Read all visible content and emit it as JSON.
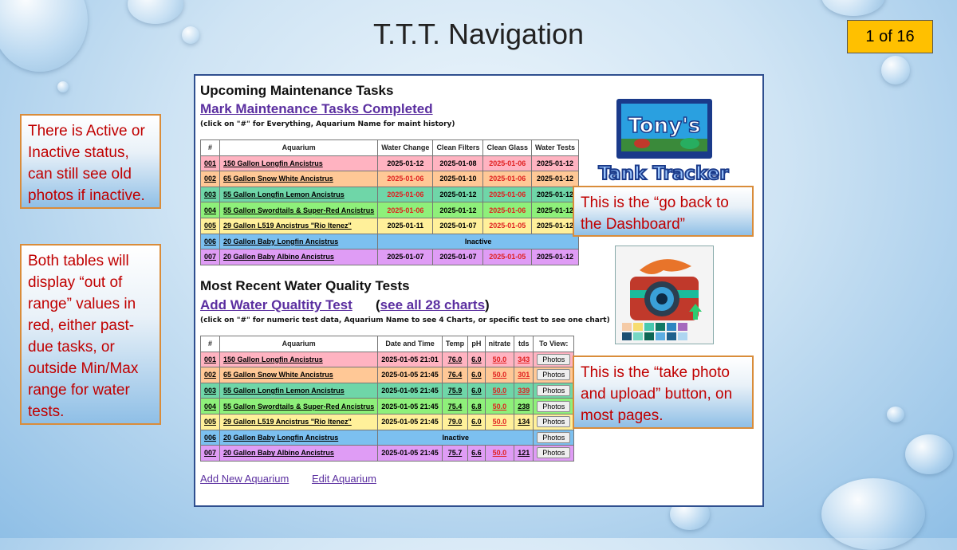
{
  "slide": {
    "title": "T.T.T. Navigation",
    "page": "1 of 16"
  },
  "callouts": {
    "status": "There is Active or Inactive status, can still see old photos if inactive.",
    "tables": "Both tables will display “out of range” values in red, either past-due tasks, or outside Min/Max range for water tests.",
    "dashboard": "This is the “go back to the Dashboard”",
    "photo": "This is the “take photo and upload” button, on most pages."
  },
  "logo": {
    "line1": "Tony's",
    "line2": "Tank Tracker"
  },
  "maintenance": {
    "heading": "Upcoming Maintenance Tasks",
    "link": "Mark Maintenance Tasks Completed",
    "note": "(click on \"#\" for Everything, Aquarium Name for maint history)",
    "columns": [
      "#",
      "Aquarium",
      "Water Change",
      "Clean Filters",
      "Clean Glass",
      "Water Tests"
    ],
    "rows": [
      {
        "num": "001",
        "name": "150 Gallon Longfin Ancistrus",
        "bg": "#ffb3c1",
        "cells": [
          [
            "2025-01-12",
            0
          ],
          [
            "2025-01-08",
            0
          ],
          [
            "2025-01-06",
            1
          ],
          [
            "2025-01-12",
            0
          ]
        ]
      },
      {
        "num": "002",
        "name": "65 Gallon Snow White Ancistrus",
        "bg": "#ffc896",
        "cells": [
          [
            "2025-01-06",
            1
          ],
          [
            "2025-01-10",
            0
          ],
          [
            "2025-01-06",
            1
          ],
          [
            "2025-01-12",
            0
          ]
        ]
      },
      {
        "num": "003",
        "name": "55 Gallon Longfin Lemon Ancistrus",
        "bg": "#6fd6a8",
        "cells": [
          [
            "2025-01-06",
            1
          ],
          [
            "2025-01-12",
            0
          ],
          [
            "2025-01-06",
            1
          ],
          [
            "2025-01-12",
            0
          ]
        ]
      },
      {
        "num": "004",
        "name": "55 Gallon Swordtails & Super-Red Ancistrus",
        "bg": "#8ef07a",
        "cells": [
          [
            "2025-01-06",
            1
          ],
          [
            "2025-01-12",
            0
          ],
          [
            "2025-01-06",
            1
          ],
          [
            "2025-01-12",
            0
          ]
        ]
      },
      {
        "num": "005",
        "name": "29 Gallon L519 Ancistrus \"Rio Itenez\"",
        "bg": "#fff09a",
        "cells": [
          [
            "2025-01-11",
            0
          ],
          [
            "2025-01-07",
            0
          ],
          [
            "2025-01-05",
            1
          ],
          [
            "2025-01-12",
            0
          ]
        ]
      },
      {
        "num": "006",
        "name": "20 Gallon Baby Longfin Ancistrus",
        "bg": "#7cc0f0",
        "inactive": "Inactive"
      },
      {
        "num": "007",
        "name": "20 Gallon Baby Albino Ancistrus",
        "bg": "#df9cf5",
        "cells": [
          [
            "2025-01-07",
            0
          ],
          [
            "2025-01-07",
            0
          ],
          [
            "2025-01-05",
            1
          ],
          [
            "2025-01-12",
            0
          ]
        ]
      }
    ]
  },
  "water": {
    "heading": "Most Recent Water Quality Tests",
    "link": "Add Water Qualtity Test",
    "charts_link": "see all 28 charts",
    "note": "(click on \"#\" for numeric test data, Aquarium Name to see 4 Charts, or specific test to see one chart)",
    "columns": [
      "#",
      "Aquarium",
      "Date and Time",
      "Temp",
      "pH",
      "nitrate",
      "tds",
      "To View:"
    ],
    "photos_label": "Photos",
    "rows": [
      {
        "num": "001",
        "name": "150 Gallon Longfin Ancistrus",
        "bg": "#ffb3c1",
        "date": "2025-01-05 21:01",
        "temp": "76.0",
        "ph": "6.0",
        "nitrate": "50.0",
        "tds": "343",
        "tds_red": true
      },
      {
        "num": "002",
        "name": "65 Gallon Snow White Ancistrus",
        "bg": "#ffc896",
        "date": "2025-01-05 21:45",
        "temp": "76.4",
        "ph": "6.0",
        "nitrate": "50.0",
        "tds": "301",
        "tds_red": true
      },
      {
        "num": "003",
        "name": "55 Gallon Longfin Lemon Ancistrus",
        "bg": "#6fd6a8",
        "date": "2025-01-05 21:45",
        "temp": "75.9",
        "ph": "6.0",
        "nitrate": "50.0",
        "tds": "339",
        "tds_red": true
      },
      {
        "num": "004",
        "name": "55 Gallon Swordtails & Super-Red Ancistrus",
        "bg": "#8ef07a",
        "date": "2025-01-05 21:45",
        "temp": "75.4",
        "ph": "6.8",
        "nitrate": "50.0",
        "tds": "238",
        "tds_red": false
      },
      {
        "num": "005",
        "name": "29 Gallon L519 Ancistrus \"Rio Itenez\"",
        "bg": "#fff09a",
        "date": "2025-01-05 21:45",
        "temp": "79.0",
        "ph": "6.0",
        "nitrate": "50.0",
        "tds": "134",
        "tds_red": false
      },
      {
        "num": "006",
        "name": "20 Gallon Baby Longfin Ancistrus",
        "bg": "#7cc0f0",
        "inactive": "Inactive"
      },
      {
        "num": "007",
        "name": "20 Gallon Baby Albino Ancistrus",
        "bg": "#df9cf5",
        "date": "2025-01-05 21:45",
        "temp": "75.7",
        "ph": "6.6",
        "nitrate": "50.0",
        "tds": "121",
        "tds_red": false
      }
    ]
  },
  "footer": {
    "add": "Add New Aquarium",
    "edit": "Edit Aquarium"
  }
}
